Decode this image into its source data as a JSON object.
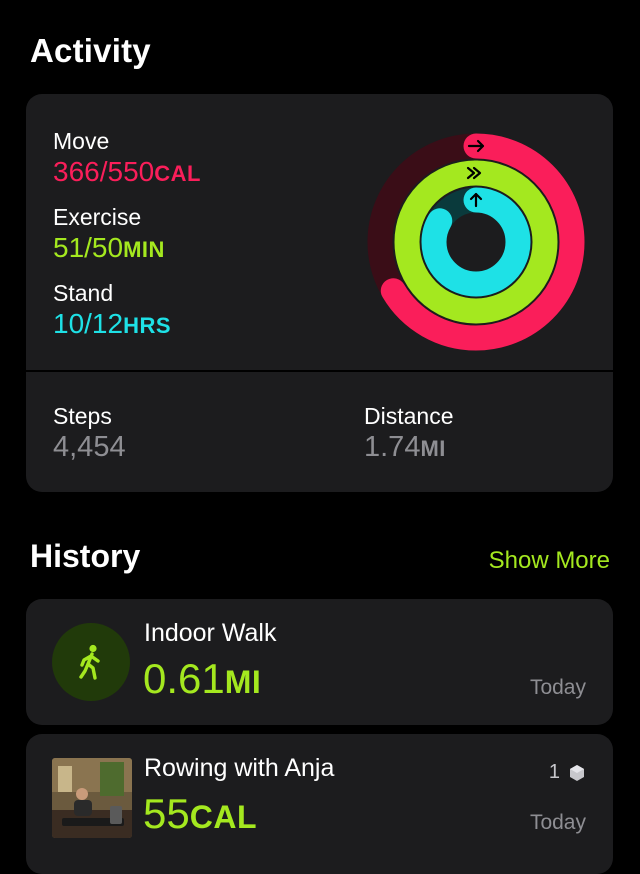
{
  "header": {
    "title": "Activity"
  },
  "activity": {
    "move": {
      "label": "Move",
      "value": "366/550",
      "unit": "CAL",
      "color": "#fa1e5a",
      "progress": 0.665
    },
    "exercise": {
      "label": "Exercise",
      "value": "51/50",
      "unit": "MIN",
      "color": "#a4e81f",
      "progress": 1.02
    },
    "stand": {
      "label": "Stand",
      "value": "10/12",
      "unit": "HRS",
      "color": "#1ee1e6",
      "progress": 0.833
    }
  },
  "stats": {
    "steps": {
      "label": "Steps",
      "value": "4,454"
    },
    "distance": {
      "label": "Distance",
      "value": "1.74",
      "unit": "MI"
    }
  },
  "history": {
    "title": "History",
    "show_more": "Show More",
    "workouts": [
      {
        "name": "Indoor Walk",
        "value": "0.61",
        "unit": "MI",
        "date": "Today",
        "icon": "walking-figure-icon"
      },
      {
        "name": "Rowing with Anja",
        "value": "55",
        "unit": "CAL",
        "date": "Today",
        "count": "1",
        "icon": "badge-icon"
      }
    ]
  },
  "colors": {
    "accent": "#a4e81f",
    "background": "#000000",
    "card": "#1c1c1e",
    "secondary_text": "#8e8e93"
  }
}
